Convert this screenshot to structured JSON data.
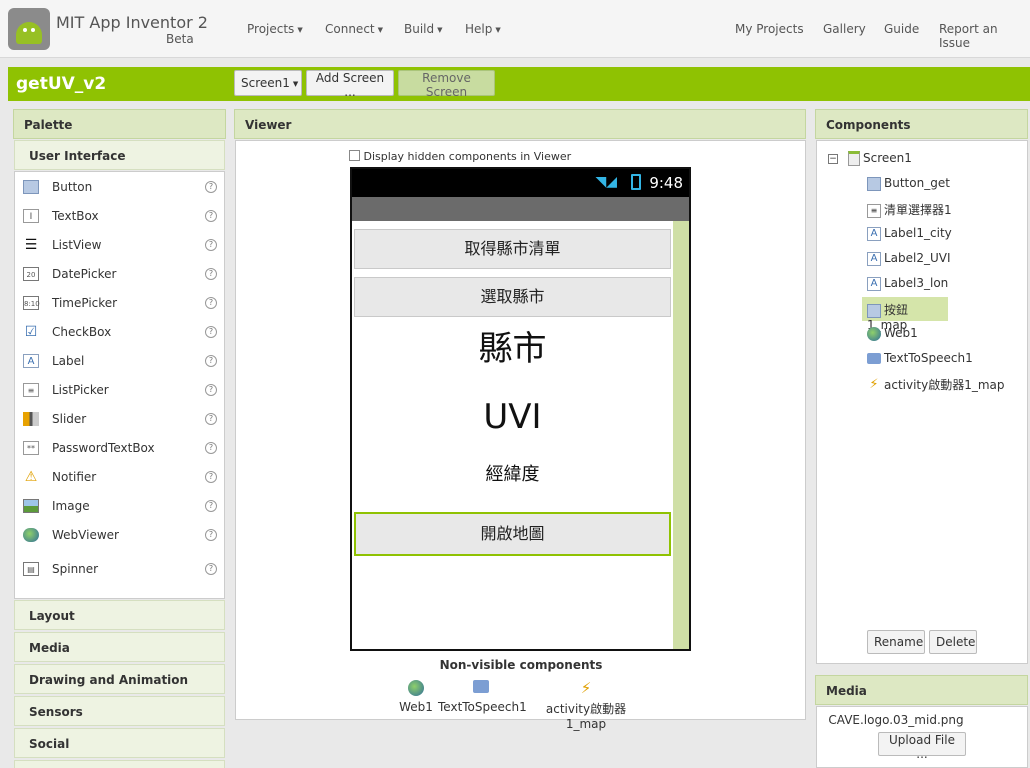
{
  "header": {
    "app_title": "MIT App Inventor 2",
    "beta": "Beta",
    "menus": [
      "Projects",
      "Connect",
      "Build",
      "Help"
    ],
    "links": [
      "My Projects",
      "Gallery",
      "Guide",
      "Report an Issue"
    ]
  },
  "project": {
    "name": "getUV_v2",
    "screen_select": "Screen1",
    "add_screen": "Add Screen ...",
    "remove_screen": "Remove Screen"
  },
  "palette": {
    "title": "Palette",
    "category_open": "User Interface",
    "items": [
      "Button",
      "TextBox",
      "ListView",
      "DatePicker",
      "TimePicker",
      "CheckBox",
      "Label",
      "ListPicker",
      "Slider",
      "PasswordTextBox",
      "Notifier",
      "Image",
      "WebViewer",
      "Spinner"
    ],
    "help": "?",
    "categories": [
      "Layout",
      "Media",
      "Drawing and Animation",
      "Sensors",
      "Social"
    ]
  },
  "viewer": {
    "title": "Viewer",
    "hidden_checkbox": "Display hidden components in Viewer",
    "time": "9:48",
    "btn1": "取得縣市清單",
    "btn2": "選取縣市",
    "label_city": "縣市",
    "label_uvi": "UVI",
    "label_lon": "經緯度",
    "btn_map": "開啟地圖",
    "nonvisible_title": "Non-visible components",
    "nonvisible": [
      "Web1",
      "TextToSpeech1",
      "activity啟動器1_map"
    ]
  },
  "components": {
    "title": "Components",
    "root": "Screen1",
    "items": [
      "Button_get",
      "清單選擇器1",
      "Label1_city",
      "Label2_UVI",
      "Label3_lon",
      "按鈕1_map",
      "Web1",
      "TextToSpeech1",
      "activity啟動器1_map"
    ],
    "rename": "Rename",
    "delete": "Delete"
  },
  "media": {
    "title": "Media",
    "file": "CAVE.logo.03_mid.png",
    "upload": "Upload File ..."
  },
  "colors": {
    "accent": "#8fc202",
    "panel_header": "#dde8c3"
  }
}
